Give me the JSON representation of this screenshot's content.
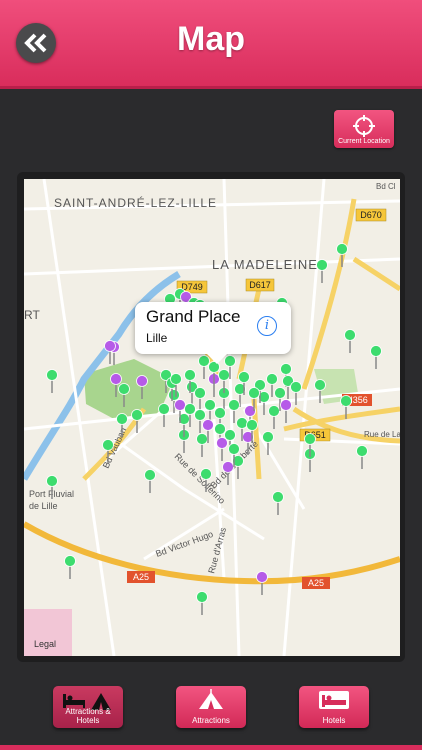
{
  "header": {
    "title": "Map",
    "back_icon": "double-chevron-left-icon"
  },
  "current_location": {
    "label": "Current Location",
    "icon": "crosshair-icon"
  },
  "map": {
    "labels": {
      "saint_andre": "SAINT-ANDRÉ-LEZ-LILLE",
      "la_madeleine": "LA MADELEINE",
      "rt": "RT",
      "bd_cl": "Bd Cl",
      "d749": "D749",
      "d617": "D617",
      "d670": "D670",
      "n356": "N356",
      "d651": "D651",
      "rue_de_la": "Rue de La",
      "bd_vauban": "Bd Vauban",
      "rue_solferino": "Rue de Solférino",
      "bd_liberte": "Bd de la Liberté",
      "bd_victor_hugo": "Bd Victor Hugo",
      "rue_arras": "Rue d'Arras",
      "port_fluvial": "Port Fluvial",
      "de_lille": "de Lille",
      "a25_left": "A25",
      "a25_right": "A25",
      "legal": "Legal"
    },
    "callout": {
      "title": "Grand Place",
      "subtitle": "Lille",
      "info_icon": "info-icon"
    },
    "pin_colors": {
      "green": "#3ddc6e",
      "purple": "#b65be8"
    }
  },
  "toolbar": {
    "attractions_hotels": "Attractions & Hotels",
    "attractions": "Attractions",
    "hotels": "Hotels"
  },
  "colors": {
    "accent": "#e23a68",
    "background": "#2b2b2d"
  }
}
